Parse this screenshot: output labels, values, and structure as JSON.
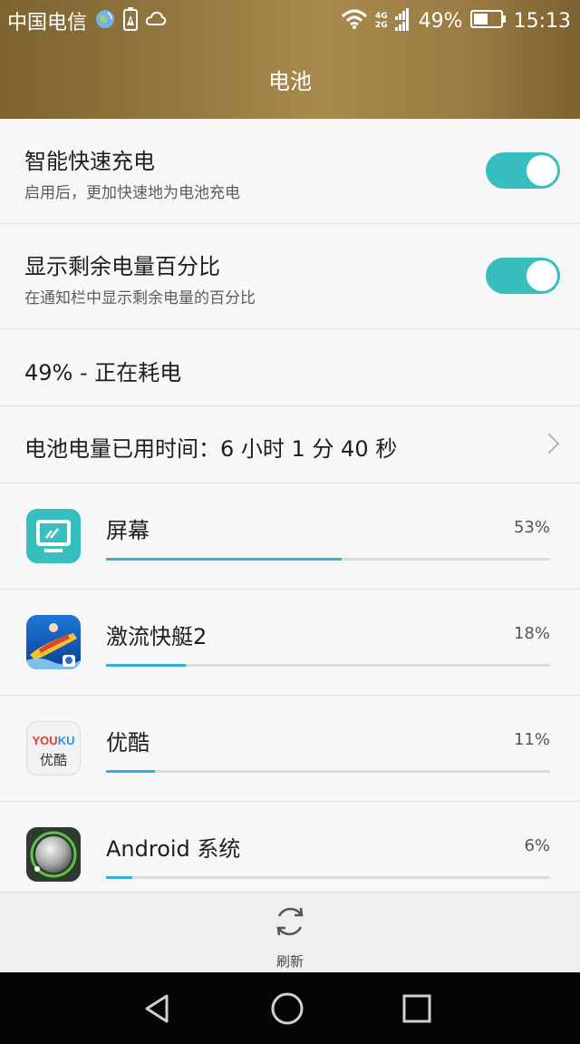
{
  "status_bar": {
    "carrier": "中国电信",
    "net_type_top": "4G",
    "net_type_bottom": "2G",
    "battery_percent": "49%",
    "time": "15:13"
  },
  "header": {
    "title": "电池"
  },
  "settings": {
    "smart_charge": {
      "title": "智能快速充电",
      "subtitle": "启用后，更加快速地为电池充电",
      "enabled": true
    },
    "show_percent": {
      "title": "显示剩余电量百分比",
      "subtitle": "在通知栏中显示剩余电量的百分比",
      "enabled": true
    },
    "status_line": "49% - 正在耗电",
    "usage_time": "电池电量已用时间：6 小时 1 分 40 秒"
  },
  "apps": [
    {
      "name": "屏幕",
      "percent_label": "53%",
      "fraction": 0.53,
      "icon": "screen-icon"
    },
    {
      "name": "激流快艇2",
      "percent_label": "18%",
      "fraction": 0.18,
      "icon": "speedboat-game-icon"
    },
    {
      "name": "优酷",
      "percent_label": "11%",
      "fraction": 0.11,
      "icon": "youku-icon",
      "icon_text_top": "YOUKU",
      "icon_text_bottom": "优酷"
    },
    {
      "name": "Android 系统",
      "percent_label": "6%",
      "fraction": 0.06,
      "icon": "android-system-icon"
    }
  ],
  "bottom_bar": {
    "refresh_label": "刷新"
  },
  "colors": {
    "accent_teal": "#37bebe",
    "progress_blue": "#33aee0",
    "header_gold": "#9a7c44"
  }
}
